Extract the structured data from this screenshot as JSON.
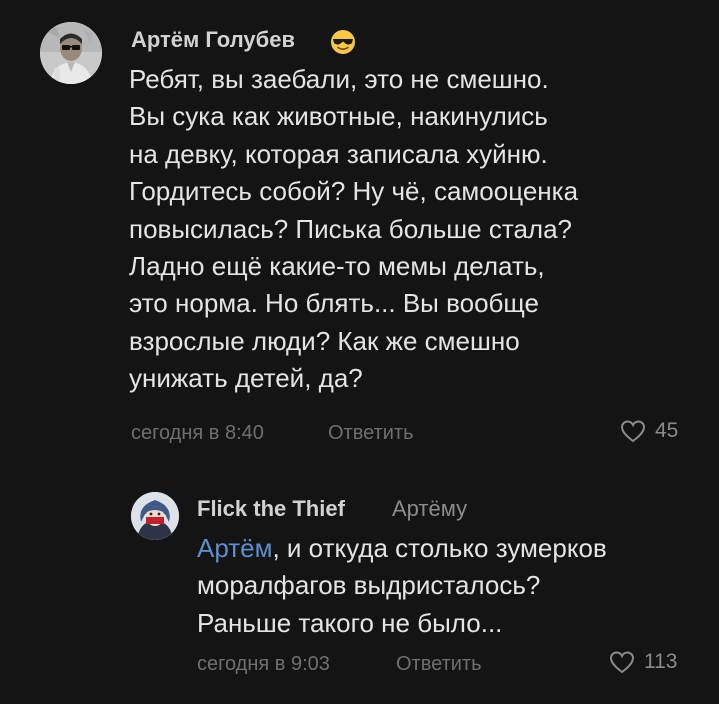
{
  "comments": [
    {
      "author": "Артём Голубев",
      "author_emoji": "sunglasses-emoji",
      "avatar": "user-photo-avatar",
      "text_lines": [
        "Ребят, вы заебали, это не смешно.",
        "Вы сука как животные, накинулись",
        "на девку, которая записала хуйню.",
        "Гордитесь собой? Ну чё, самооценка",
        "повысилась? Писька больше стала?",
        "Ладно ещё какие-то мемы делать,",
        "это норма. Но блять... Вы вообще",
        "взрослые люди? Как же смешно",
        "унижать детей, да?"
      ],
      "time": "сегодня в 8:40",
      "reply_label": "Ответить",
      "likes": "45",
      "like_icon": "heart-icon"
    },
    {
      "author": "Flick the Thief",
      "reply_to": "Артёму",
      "avatar": "anime-character-avatar",
      "mention": "Артём",
      "first_line_rest": ", и откуда столько зумерков",
      "text_lines": [
        "моралфагов выдристалось?",
        "Раньше такого не было..."
      ],
      "time": "сегодня в 9:03",
      "reply_label": "Ответить",
      "likes": "113",
      "like_icon": "heart-icon"
    }
  ],
  "colors": {
    "background": "#141414",
    "text": "#e4e4e4",
    "author": "#d2d2d2",
    "meta": "#6f6f6f",
    "mention": "#5b8fd0"
  }
}
